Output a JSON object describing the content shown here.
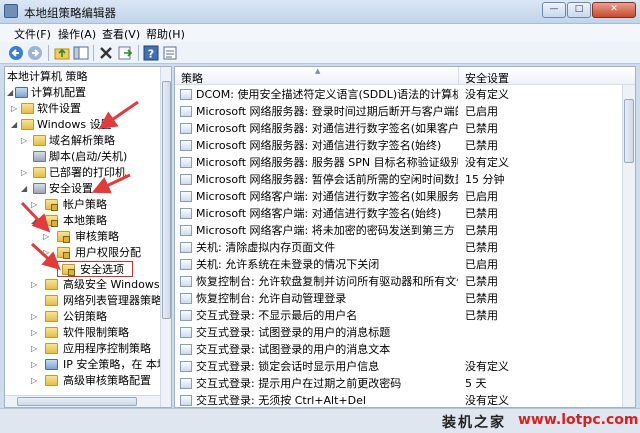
{
  "window": {
    "title": "本地组策略编辑器",
    "btn_min": "—",
    "btn_max": "□",
    "btn_close": "✕"
  },
  "menu": {
    "file": "文件(F)",
    "action": "操作(A)",
    "view": "查看(V)",
    "help": "帮助(H)"
  },
  "toolbar": {
    "icons": [
      "back-icon",
      "forward-icon",
      "up-folder-icon",
      "show-hide-tree-icon",
      "delete-icon",
      "export-list-icon",
      "help-icon",
      "properties-icon"
    ]
  },
  "tree": {
    "n0": "本地计算机 策略",
    "n1": "计算机配置",
    "n2": "软件设置",
    "n3": "Windows 设置",
    "n4": "域名解析策略",
    "n5": "脚本(启动/关机)",
    "n6": "已部署的打印机",
    "n7": "安全设置",
    "n8": "帐户策略",
    "n9": "本地策略",
    "n10": "审核策略",
    "n11": "用户权限分配",
    "n12": "安全选项",
    "n13": "高级安全 Windows 防",
    "n14": "网络列表管理器策略",
    "n15": "公钥策略",
    "n16": "软件限制策略",
    "n17": "应用程序控制策略",
    "n18": "IP 安全策略，在 本地",
    "n19": "高级审核策略配置"
  },
  "list": {
    "col_policy": "策略",
    "col_setting": "安全设置",
    "rows": [
      {
        "name": "DCOM: 使用安全描述符定义语言(SDDL)语法的计算机启动...",
        "value": "没有定义"
      },
      {
        "name": "Microsoft 网络服务器: 登录时间过期后断开与客户端的连接",
        "value": "已启用"
      },
      {
        "name": "Microsoft 网络服务器: 对通信进行数字签名(如果客户端允...",
        "value": "已禁用"
      },
      {
        "name": "Microsoft 网络服务器: 对通信进行数字签名(始终)",
        "value": "已禁用"
      },
      {
        "name": "Microsoft 网络服务器: 服务器 SPN 目标名称验证级别",
        "value": "没有定义"
      },
      {
        "name": "Microsoft 网络服务器: 暂停会话前所需的空闲时间数量",
        "value": "15 分钟"
      },
      {
        "name": "Microsoft 网络客户端: 对通信进行数字签名(如果服务器允...",
        "value": "已启用"
      },
      {
        "name": "Microsoft 网络客户端: 对通信进行数字签名(始终)",
        "value": "已禁用"
      },
      {
        "name": "Microsoft 网络客户端: 将未加密的密码发送到第三方 SMB...",
        "value": "已禁用"
      },
      {
        "name": "关机: 清除虚拟内存页面文件",
        "value": "已禁用"
      },
      {
        "name": "关机: 允许系统在未登录的情况下关闭",
        "value": "已启用"
      },
      {
        "name": "恢复控制台: 允许软盘复制并访问所有驱动器和所有文件夹",
        "value": "已禁用"
      },
      {
        "name": "恢复控制台: 允许自动管理登录",
        "value": "已禁用"
      },
      {
        "name": "交互式登录: 不显示最后的用户名",
        "value": "已禁用"
      },
      {
        "name": "交互式登录: 试图登录的用户的消息标题",
        "value": ""
      },
      {
        "name": "交互式登录: 试图登录的用户的消息文本",
        "value": ""
      },
      {
        "name": "交互式登录: 锁定会话时显示用户信息",
        "value": "没有定义"
      },
      {
        "name": "交互式登录: 提示用户在过期之前更改密码",
        "value": "5 天"
      },
      {
        "name": "交互式登录: 无须按 Ctrl+Alt+Del",
        "value": "没有定义"
      }
    ]
  },
  "watermark": {
    "name": "装机之家",
    "url": "www.lotpc.com"
  }
}
